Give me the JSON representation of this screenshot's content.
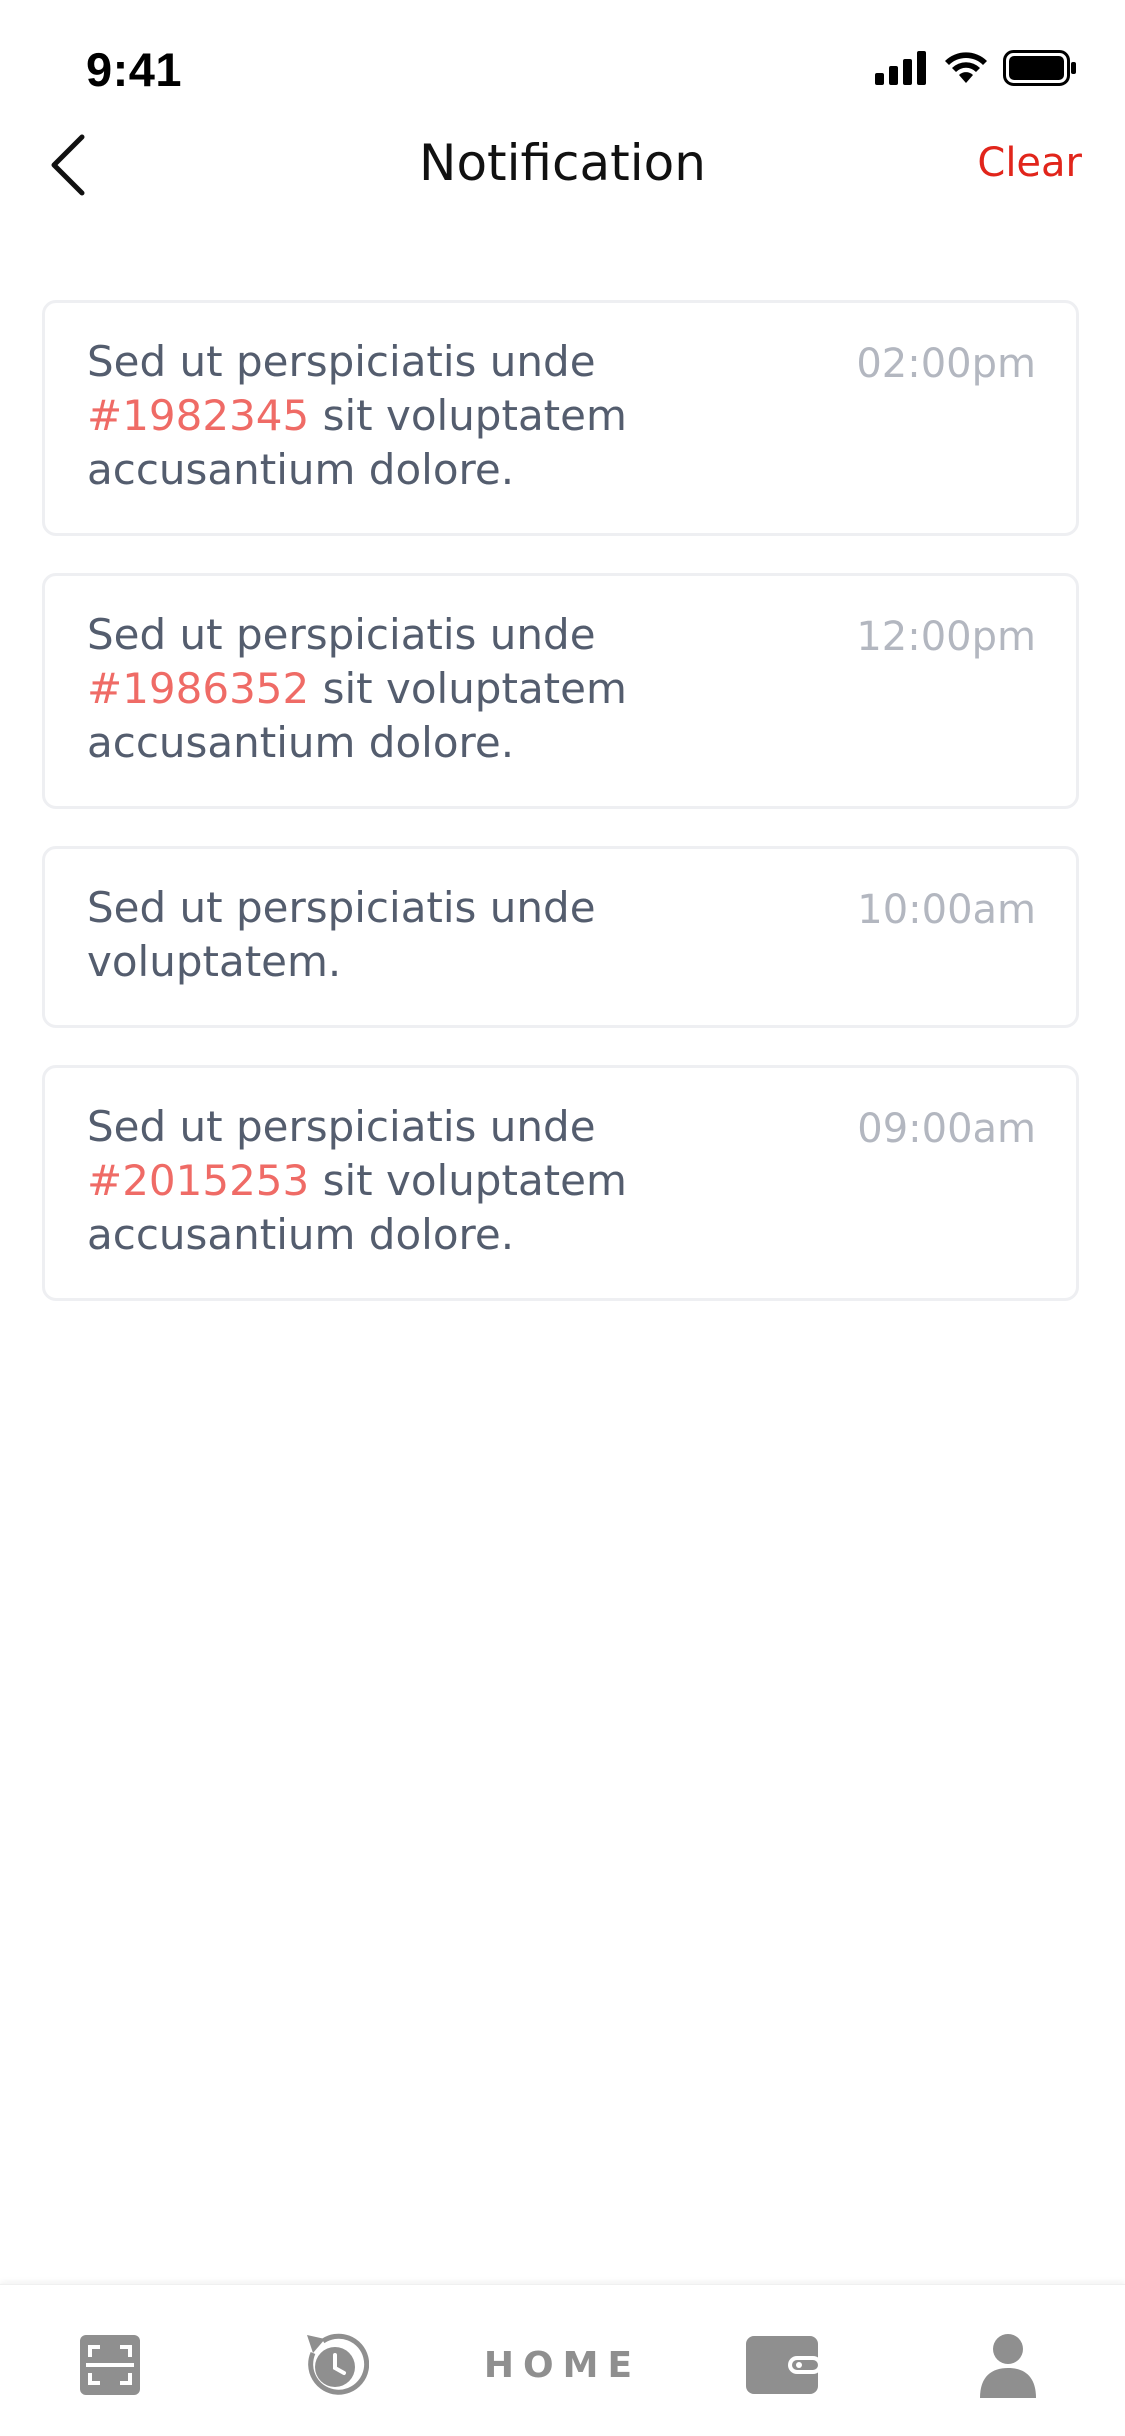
{
  "status_bar": {
    "time": "9:41"
  },
  "header": {
    "title": "Notification",
    "clear_label": "Clear"
  },
  "notifications": [
    {
      "text_before": "Sed ut perspiciatis unde ",
      "ref": "#1982345",
      "text_after": " sit voluptatem accusantium dolore.",
      "time": "02:00pm"
    },
    {
      "text_before": "Sed ut perspiciatis unde ",
      "ref": "#1986352",
      "text_after": " sit voluptatem accusantium dolore.",
      "time": "12:00pm"
    },
    {
      "text_before": "Sed ut perspiciatis unde voluptatem.",
      "ref": "",
      "text_after": "",
      "time": "10:00am"
    },
    {
      "text_before": "Sed ut perspiciatis unde ",
      "ref": "#2015253",
      "text_after": " sit voluptatem accusantium dolore.",
      "time": "09:00am"
    }
  ],
  "tab_bar": {
    "home_label": "HOME",
    "icons": [
      "scan-icon",
      "history-icon",
      "wallet-icon",
      "profile-icon"
    ]
  },
  "colors": {
    "accent": "#e1251b",
    "reference": "#ef6b66",
    "body_text": "#545d6e",
    "time_text": "#b3b7c0",
    "tab_icon": "#8f8f8f"
  }
}
